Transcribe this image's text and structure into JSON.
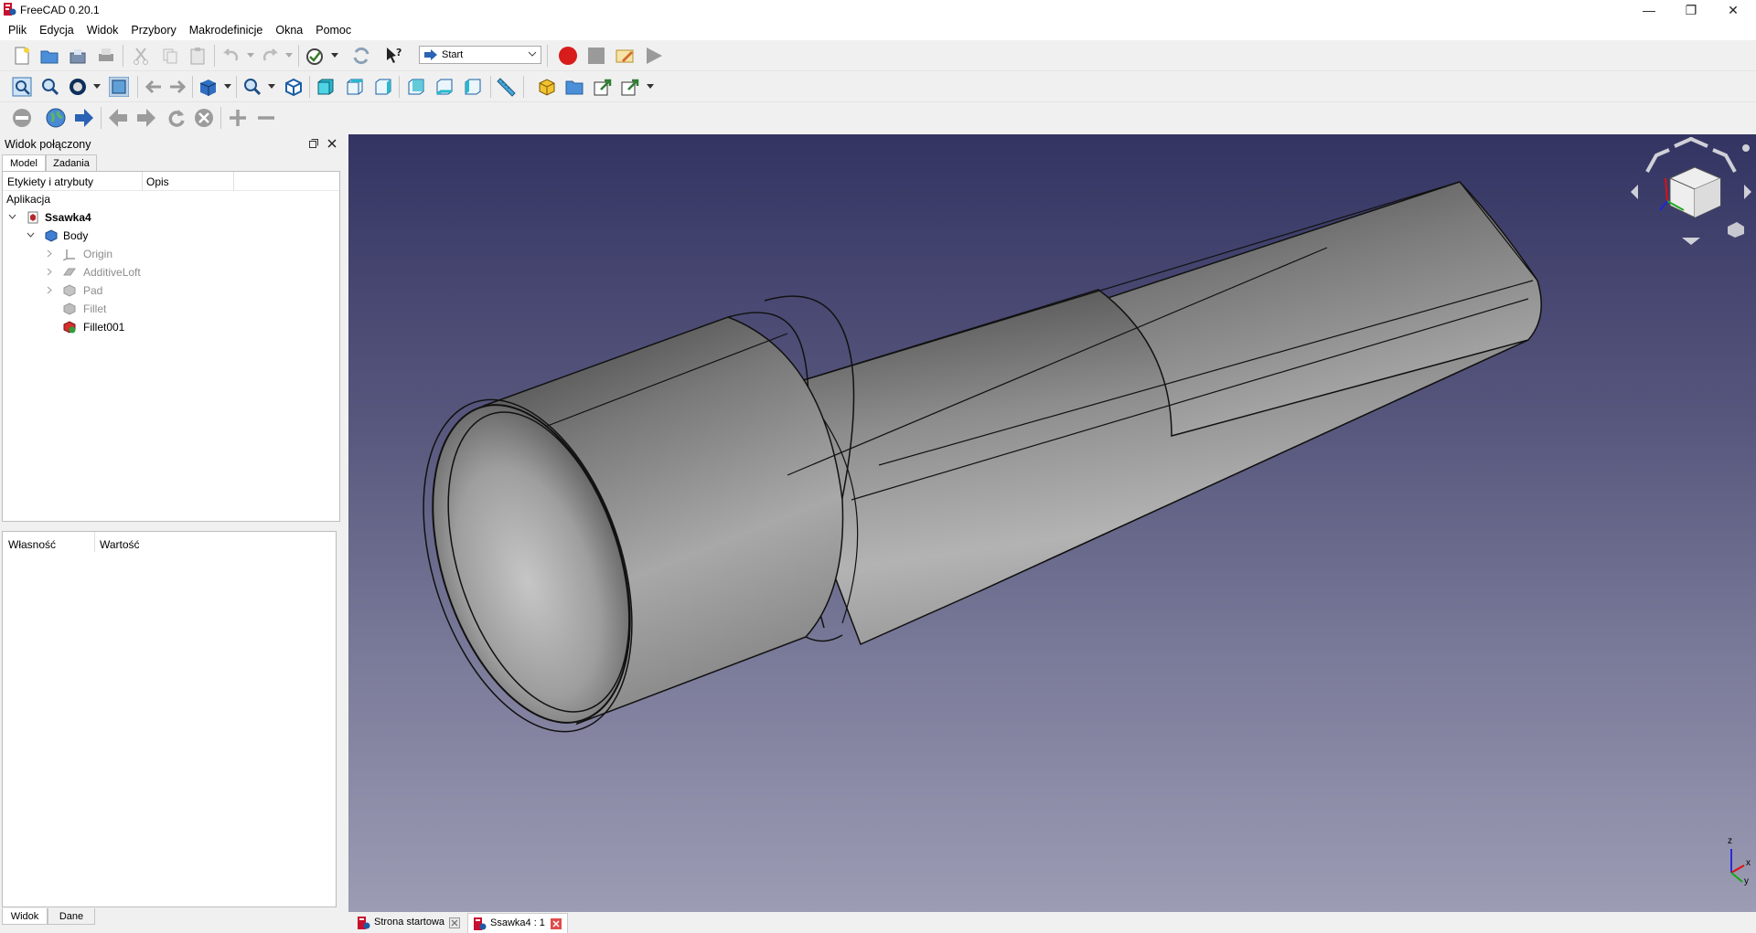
{
  "window": {
    "title": "FreeCAD 0.20.1",
    "minimize": "—",
    "maximize": "❐",
    "close": "✕"
  },
  "menu": [
    "Plik",
    "Edycja",
    "Widok",
    "Przybory",
    "Makrodefinicje",
    "Okna",
    "Pomoc"
  ],
  "workbench": {
    "selected": "Start"
  },
  "combo_view": {
    "title": "Widok połączony",
    "tabs": [
      "Model",
      "Zadania"
    ],
    "tree_headers": [
      "Etykiety i atrybuty",
      "Opis"
    ],
    "app_label": "Aplikacja",
    "tree": [
      {
        "label": "Ssawka4",
        "level": 0,
        "bold": true,
        "expanded": true
      },
      {
        "label": "Body",
        "level": 1,
        "expanded": true
      },
      {
        "label": "Origin",
        "level": 2,
        "collapsed": true,
        "hidden": true
      },
      {
        "label": "AdditiveLoft",
        "level": 2,
        "collapsed": true,
        "hidden": true
      },
      {
        "label": "Pad",
        "level": 2,
        "collapsed": true,
        "hidden": true
      },
      {
        "label": "Fillet",
        "level": 2,
        "hidden": true
      },
      {
        "label": "Fillet001",
        "level": 2
      }
    ]
  },
  "properties": {
    "headers": [
      "Własność",
      "Wartość"
    ],
    "tabs": [
      "Widok",
      "Dane"
    ]
  },
  "doc_tabs": [
    {
      "label": "Strona startowa",
      "active": false
    },
    {
      "label": "Ssawka4 : 1",
      "active": true
    }
  ],
  "axis": {
    "x": "x",
    "y": "y",
    "z": "z"
  },
  "colors": {
    "viewport_top": "#343463",
    "viewport_bottom": "#9c9cb4",
    "record": "#d81c1c"
  }
}
